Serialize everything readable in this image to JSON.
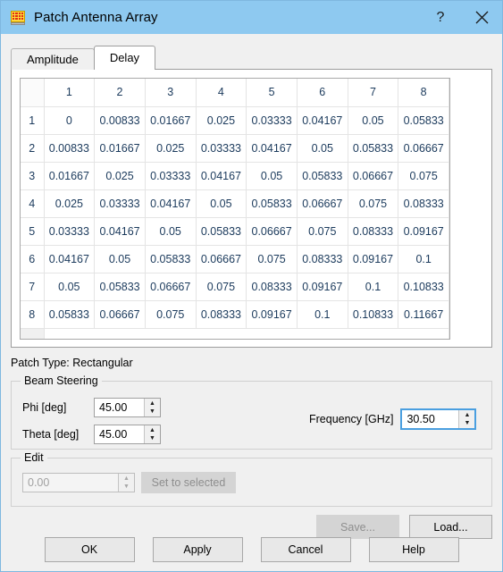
{
  "window": {
    "title": "Patch Antenna Array",
    "icon": "patch-array-icon",
    "help_label": "?",
    "close_label": "✕",
    "titlebar_color": "#8ec9f0"
  },
  "tabs": [
    {
      "label": "Amplitude",
      "selected": false
    },
    {
      "label": "Delay",
      "selected": true
    }
  ],
  "table": {
    "corner_label": "",
    "column_headers": [
      "1",
      "2",
      "3",
      "4",
      "5",
      "6",
      "7",
      "8"
    ],
    "row_headers": [
      "1",
      "2",
      "3",
      "4",
      "5",
      "6",
      "7",
      "8"
    ],
    "rows": [
      [
        "0",
        "0.00833",
        "0.01667",
        "0.025",
        "0.03333",
        "0.04167",
        "0.05",
        "0.05833"
      ],
      [
        "0.00833",
        "0.01667",
        "0.025",
        "0.03333",
        "0.04167",
        "0.05",
        "0.05833",
        "0.06667"
      ],
      [
        "0.01667",
        "0.025",
        "0.03333",
        "0.04167",
        "0.05",
        "0.05833",
        "0.06667",
        "0.075"
      ],
      [
        "0.025",
        "0.03333",
        "0.04167",
        "0.05",
        "0.05833",
        "0.06667",
        "0.075",
        "0.08333"
      ],
      [
        "0.03333",
        "0.04167",
        "0.05",
        "0.05833",
        "0.06667",
        "0.075",
        "0.08333",
        "0.09167"
      ],
      [
        "0.04167",
        "0.05",
        "0.05833",
        "0.06667",
        "0.075",
        "0.08333",
        "0.09167",
        "0.1"
      ],
      [
        "0.05",
        "0.05833",
        "0.06667",
        "0.075",
        "0.08333",
        "0.09167",
        "0.1",
        "0.10833"
      ],
      [
        "0.05833",
        "0.06667",
        "0.075",
        "0.08333",
        "0.09167",
        "0.1",
        "0.10833",
        "0.11667"
      ]
    ]
  },
  "patch_type": {
    "text": "Patch Type: Rectangular"
  },
  "beam_steering": {
    "title": "Beam Steering",
    "phi": {
      "label": "Phi [deg]",
      "value": "45.00"
    },
    "theta": {
      "label": "Theta [deg]",
      "value": "45.00"
    },
    "frequency": {
      "label": "Frequency [GHz]",
      "value": "30.50",
      "focused": true
    }
  },
  "edit": {
    "title": "Edit",
    "value": "0.00",
    "set_to_selected_label": "Set to selected"
  },
  "file_buttons": {
    "save_label": "Save...",
    "load_label": "Load..."
  },
  "dialog_buttons": {
    "ok": "OK",
    "apply": "Apply",
    "cancel": "Cancel",
    "help": "Help"
  },
  "spinner": {
    "up": "▲",
    "down": "▼"
  }
}
